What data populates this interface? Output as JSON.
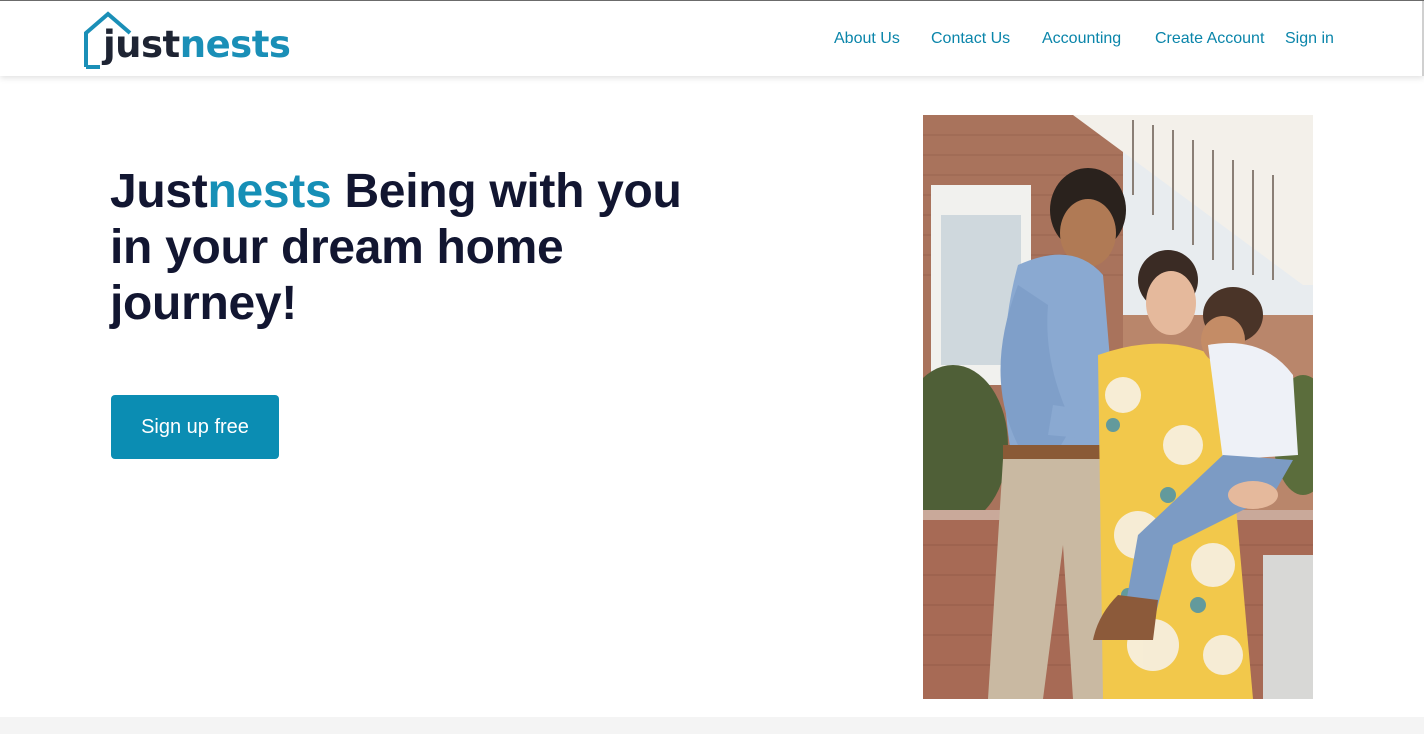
{
  "brand": {
    "logo_just": "just",
    "logo_nests": "nests",
    "color_dark": "#1e2433",
    "color_accent": "#1a8fb7"
  },
  "nav": {
    "items": [
      {
        "label": "About Us"
      },
      {
        "label": "Contact Us"
      },
      {
        "label": "Accounting"
      },
      {
        "label": "Create Account"
      },
      {
        "label": "Sign in"
      }
    ],
    "link_color": "#0a85aa"
  },
  "hero": {
    "title_brand_plain": "Just",
    "title_brand_accent": "nests",
    "title_rest": " Being with you in your dream home journey!",
    "cta_label": "Sign up free",
    "cta_color": "#0b8db3",
    "title_color": "#121631"
  },
  "photo": {
    "icon": "family-photo"
  }
}
